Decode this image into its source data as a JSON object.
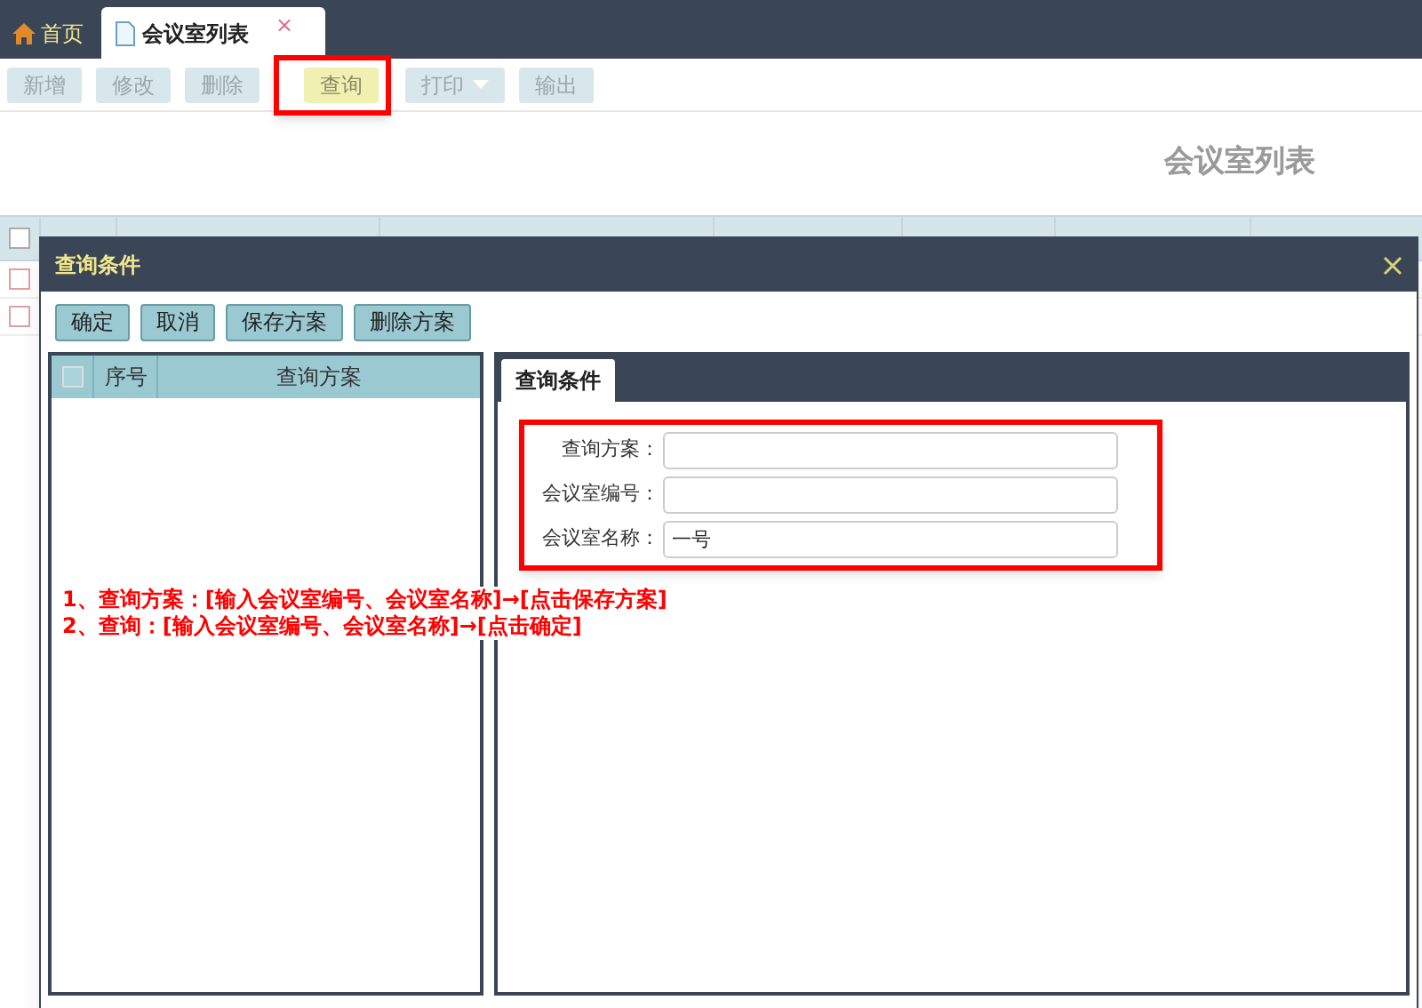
{
  "tabs": [
    {
      "label": "首页",
      "selected": false
    },
    {
      "label": "会议室列表",
      "selected": true,
      "close": "×"
    }
  ],
  "toolbar": [
    {
      "label": "新增",
      "highlighted": false
    },
    {
      "label": "修改",
      "highlighted": false
    },
    {
      "label": "删除",
      "highlighted": false
    },
    {
      "label": "查询",
      "highlighted": true
    },
    {
      "label": "打印",
      "highlighted": false,
      "dropdown": true
    },
    {
      "label": "输出",
      "highlighted": false
    }
  ],
  "page_title": "会议室列表",
  "table": {
    "all_checked": false,
    "rows": [
      {
        "checked": false
      },
      {
        "checked": false
      }
    ]
  },
  "dialog": {
    "title": "查询条件",
    "buttons": [
      "确定",
      "取消",
      "保存方案",
      "删除方案"
    ],
    "scheme_list": {
      "columns": [
        "序号",
        "查询方案"
      ],
      "all_checked": false
    },
    "tabs": [
      {
        "label": "查询条件",
        "selected": true
      }
    ],
    "fields": [
      {
        "label": "查询方案："
      },
      {
        "label": "会议室编号："
      },
      {
        "label": "会议室名称：",
        "value": "一号"
      }
    ],
    "notes": [
      "1、查询方案：[输入会议室编号、会议室名称]→[点击保存方案]",
      "2、查询：[输入会议室编号、会议室名称]→[点击确定]"
    ]
  }
}
